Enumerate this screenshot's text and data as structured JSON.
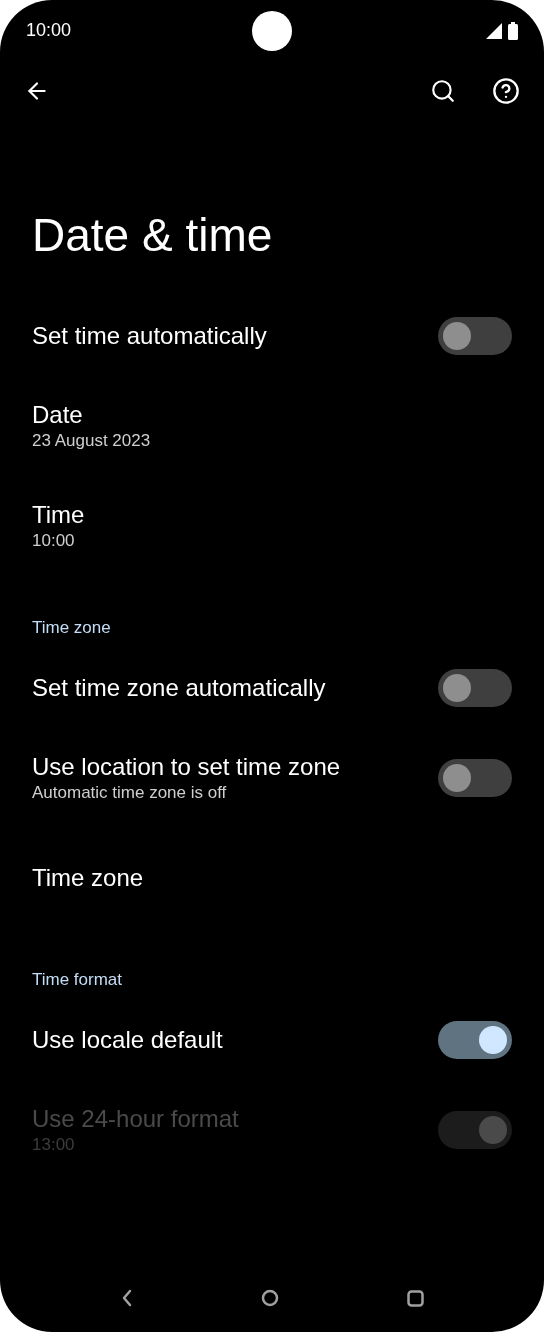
{
  "status_bar": {
    "time": "10:00"
  },
  "title": "Date & time",
  "rows": [
    {
      "kind": "switch",
      "title": "Set time automatically",
      "on": false,
      "disabled": false
    },
    {
      "kind": "info",
      "title": "Date",
      "summary": "23 August 2023"
    },
    {
      "kind": "info",
      "title": "Time",
      "summary": "10:00"
    },
    {
      "kind": "header",
      "title": "Time zone"
    },
    {
      "kind": "switch",
      "title": "Set time zone automatically",
      "on": false,
      "disabled": false
    },
    {
      "kind": "switch",
      "title": "Use location to set time zone",
      "summary": "Automatic time zone is off",
      "on": false,
      "disabled": false
    },
    {
      "kind": "info",
      "title": "Time zone"
    },
    {
      "kind": "header",
      "title": "Time format"
    },
    {
      "kind": "switch",
      "title": "Use locale default",
      "on": true,
      "disabled": false
    },
    {
      "kind": "switch",
      "title": "Use 24-hour format",
      "summary": "13:00",
      "on": true,
      "disabled": true
    }
  ]
}
